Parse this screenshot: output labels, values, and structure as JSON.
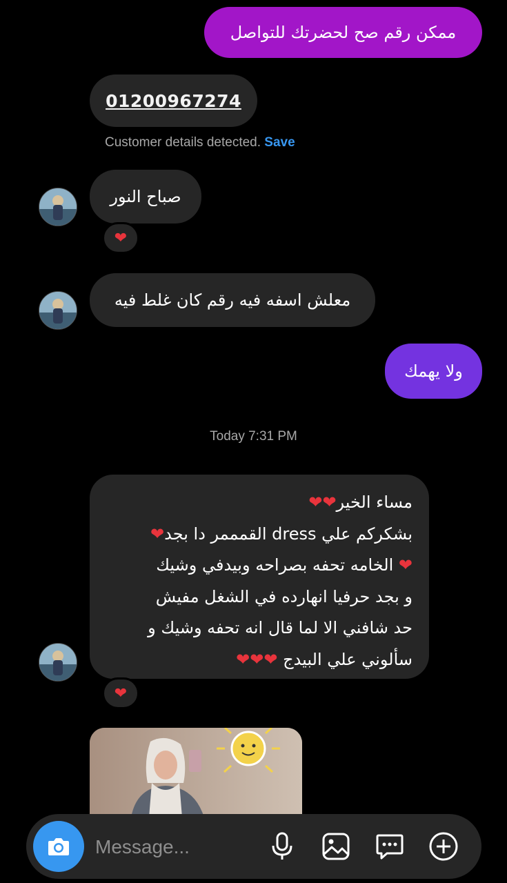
{
  "messages": {
    "out_1": "ممكن رقم صح لحضرتك للتواصل",
    "phone_number": "01200967274",
    "customer_details": "Customer details detected.",
    "save_label": "Save",
    "in_1": "صباح النور",
    "in_1_reaction": "❤",
    "in_2": "معلش اسفه فيه رقم كان غلط فيه",
    "out_2": "ولا يهمك",
    "timestamp": "Today 7:31 PM",
    "long_lines": [
      "مساء الخير",
      "بشكركم علي dress القمممر دا بجد",
      "الخامه تحفه بصراحه وبيدفي وشيك",
      "و بجد حرفيا انهارده في الشغل مفيش",
      "حد شافني الا لما قال انه تحفه وشيك و",
      "سألوني علي البيدج"
    ],
    "hearts": {
      "line1": "❤❤",
      "line2": "❤",
      "line3": "❤",
      "line6": "❤❤❤"
    },
    "long_reaction": "❤"
  },
  "composer": {
    "placeholder": "Message..."
  },
  "icons": [
    "camera-icon",
    "microphone-icon",
    "gallery-icon",
    "sticker-icon",
    "plus-icon"
  ],
  "colors": {
    "out_bubble_top": "#a216c8",
    "out_bubble_bottom": "#7433e0",
    "in_bubble": "#262626",
    "accent": "#3797f0",
    "heart": "#e8343c"
  }
}
